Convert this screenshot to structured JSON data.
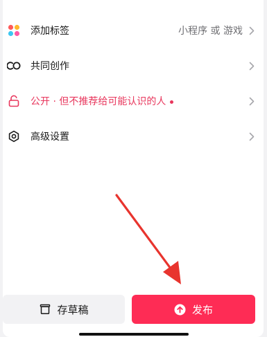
{
  "rows": [
    {
      "icon": "colorful-dots-icon",
      "label": "添加标签",
      "value": "小程序 或 游戏"
    },
    {
      "icon": "co-creation-icon",
      "label": "共同创作",
      "value": ""
    },
    {
      "icon": "unlock-icon",
      "label": "公开 · 但不推荐给可能认识的人",
      "value": ""
    },
    {
      "icon": "hexagon-settings-icon",
      "label": "高级设置",
      "value": ""
    }
  ],
  "buttons": {
    "draft_label": "存草稿",
    "publish_label": "发布"
  },
  "colors": {
    "accent": "#fe2c55",
    "danger_text": "#e8365c",
    "annotation_arrow": "#e8342e"
  }
}
